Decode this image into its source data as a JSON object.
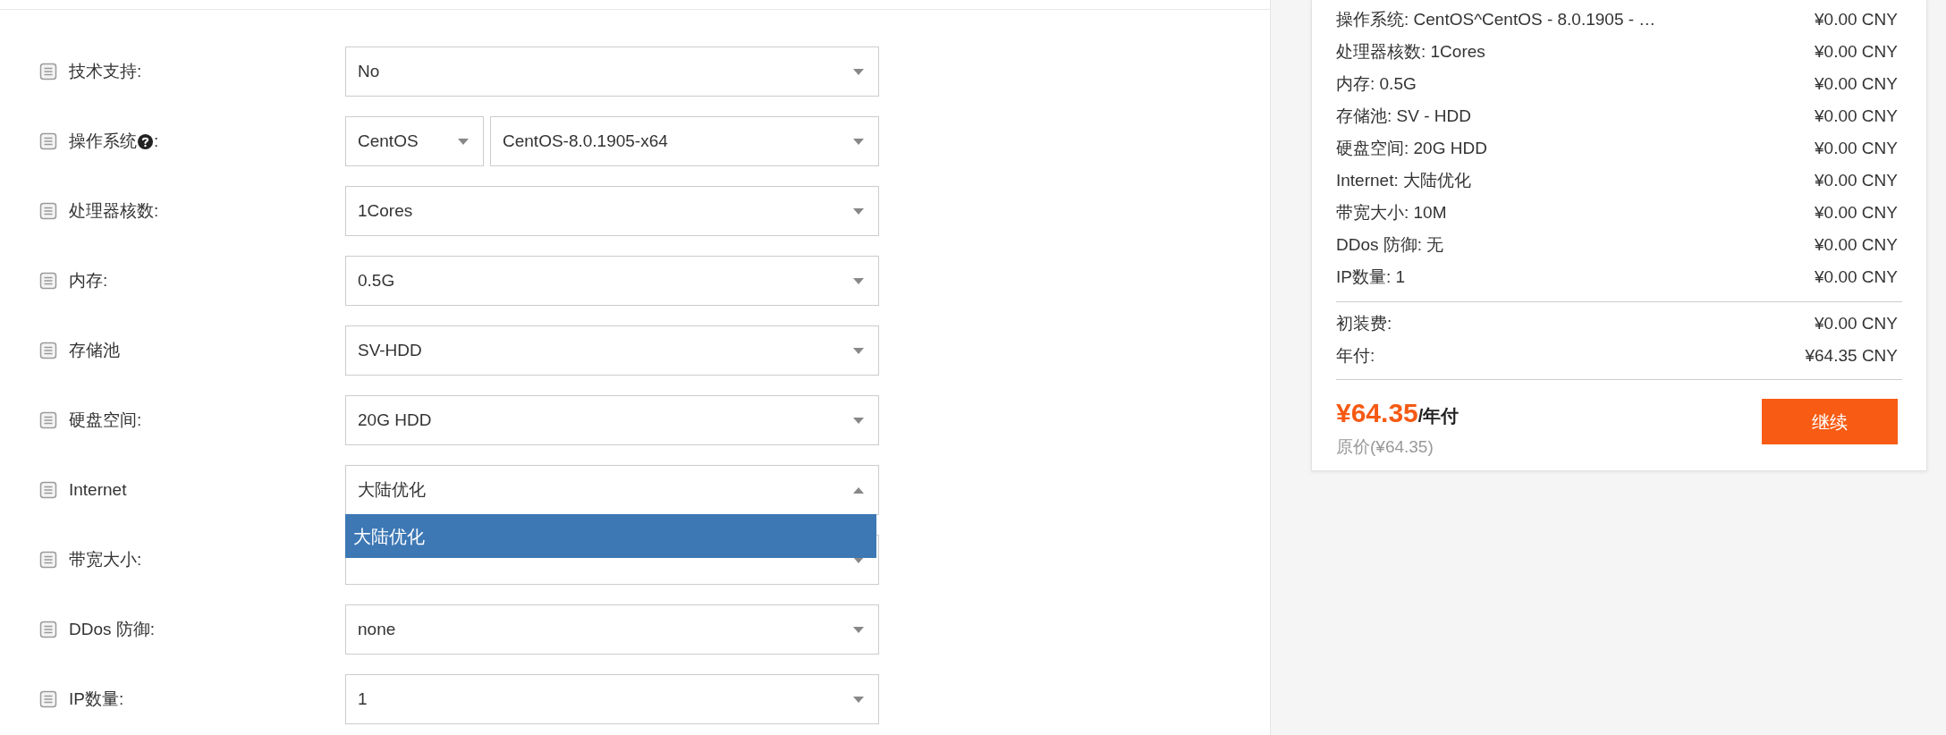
{
  "form": {
    "fields": [
      {
        "label": "技术支持:",
        "selects": [
          {
            "value": "No",
            "open": false
          }
        ]
      },
      {
        "label": "操作系统",
        "help": true,
        "label_after": ":",
        "selects": [
          {
            "value": "CentOS",
            "open": false
          },
          {
            "value": "CentOS-8.0.1905-x64",
            "open": false
          }
        ]
      },
      {
        "label": "处理器核数:",
        "selects": [
          {
            "value": "1Cores",
            "open": false
          }
        ]
      },
      {
        "label": "内存:",
        "selects": [
          {
            "value": "0.5G",
            "open": false
          }
        ]
      },
      {
        "label": "存储池",
        "selects": [
          {
            "value": "SV-HDD",
            "open": false
          }
        ]
      },
      {
        "label": "硬盘空间:",
        "selects": [
          {
            "value": "20G HDD",
            "open": false
          }
        ]
      },
      {
        "label": "Internet",
        "selects": [
          {
            "value": "大陆优化",
            "open": true,
            "options": [
              {
                "label": "大陆优化",
                "selected": true
              }
            ]
          }
        ]
      },
      {
        "label": "带宽大小:",
        "selects": [
          {
            "open": false
          }
        ]
      },
      {
        "label": "DDos 防御:",
        "selects": [
          {
            "value": "none",
            "open": false
          }
        ]
      },
      {
        "label": "IP数量:",
        "selects": [
          {
            "value": "1",
            "open": false
          }
        ]
      }
    ]
  },
  "summary": {
    "items": [
      {
        "text": "操作系统: CentOS^CentOS - 8.0.1905 - …",
        "price": "¥0.00 CNY"
      },
      {
        "text": "处理器核数: 1Cores",
        "price": "¥0.00 CNY"
      },
      {
        "text": "内存: 0.5G",
        "price": "¥0.00 CNY"
      },
      {
        "text": "存储池: SV - HDD",
        "price": "¥0.00 CNY"
      },
      {
        "text": "硬盘空间: 20G HDD",
        "price": "¥0.00 CNY"
      },
      {
        "text": "Internet: 大陆优化",
        "price": "¥0.00 CNY"
      },
      {
        "text": "带宽大小: 10M",
        "price": "¥0.00 CNY"
      },
      {
        "text": "DDos 防御: 无",
        "price": "¥0.00 CNY"
      },
      {
        "text": "IP数量: 1",
        "price": "¥0.00 CNY"
      }
    ],
    "fees": [
      {
        "text": "初装费:",
        "price": "¥0.00 CNY"
      },
      {
        "text": "年付:",
        "price": "¥64.35 CNY"
      }
    ],
    "total": {
      "price": "¥64.35",
      "period": "/年付",
      "original": "原价(¥64.35)"
    },
    "button": "继续"
  }
}
